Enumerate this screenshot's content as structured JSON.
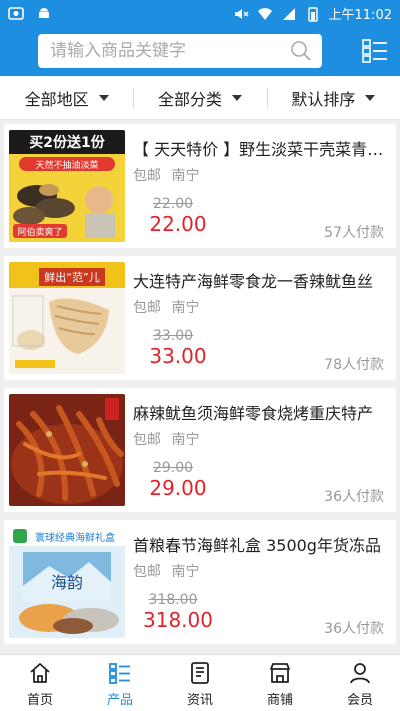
{
  "status_bar": {
    "time": "上午11:02"
  },
  "search": {
    "placeholder": "请输入商品关键字"
  },
  "filters": [
    {
      "label": "全部地区"
    },
    {
      "label": "全部分类"
    },
    {
      "label": "默认排序"
    }
  ],
  "products": [
    {
      "title": "【 天天特价 】野生淡菜干壳菜青口贝",
      "shipping": "包邮",
      "location": "南宁",
      "original_price": "22.00",
      "price": "22.00",
      "sold": "57人付款",
      "image_text": [
        "买2份送1份",
        "天然不抽油淡菜",
        "阿伯卖爽了"
      ]
    },
    {
      "title": "大连特产海鲜零食龙一香辣鱿鱼丝",
      "shipping": "包邮",
      "location": "南宁",
      "original_price": "33.00",
      "price": "33.00",
      "sold": "78人付款",
      "image_text": [
        "鲜出“范”儿"
      ]
    },
    {
      "title": "麻辣鱿鱼须海鲜零食烧烤重庆特产",
      "shipping": "包邮",
      "location": "南宁",
      "original_price": "29.00",
      "price": "29.00",
      "sold": "36人付款",
      "image_text": []
    },
    {
      "title": "首粮春节海鲜礼盒 3500g年货冻品",
      "shipping": "包邮",
      "location": "南宁",
      "original_price": "318.00",
      "price": "318.00",
      "sold": "36人付款",
      "image_text": [
        "寰球经典海鲜礼盒",
        "海韵"
      ]
    }
  ],
  "tabbar": [
    {
      "label": "首页",
      "icon": "home-icon",
      "active": false
    },
    {
      "label": "产品",
      "icon": "list-icon",
      "active": true
    },
    {
      "label": "资讯",
      "icon": "news-icon",
      "active": false
    },
    {
      "label": "商铺",
      "icon": "shop-icon",
      "active": false
    },
    {
      "label": "会员",
      "icon": "user-icon",
      "active": false
    }
  ],
  "colors": {
    "brand": "#1e8ee0",
    "price": "#e0232b"
  }
}
